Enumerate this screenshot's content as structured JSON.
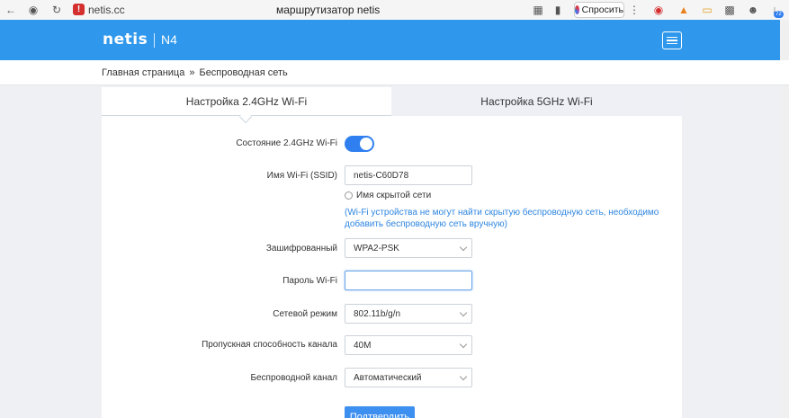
{
  "browser": {
    "url": "netis.cc",
    "page_title": "маршрутизатор netis",
    "ask_label": "Спросить",
    "security_badge": "!",
    "counter_badge": "72"
  },
  "header": {
    "brand": "netis",
    "model": "N4"
  },
  "breadcrumb": {
    "home": "Главная страница",
    "separator": "»",
    "current": "Беспроводная сеть"
  },
  "tabs": [
    {
      "label": "Настройка 2.4GHz Wi-Fi",
      "active": true
    },
    {
      "label": "Настройка 5GHz Wi-Fi",
      "active": false
    }
  ],
  "form": {
    "state_label": "Состояние 2.4GHz Wi-Fi",
    "state_on": true,
    "ssid_label": "Имя Wi-Fi (SSID)",
    "ssid_value": "netis-C60D78",
    "hidden_label": "Имя скрытой сети",
    "hidden_hint": "(Wi-Fi устройства не могут найти скрытую беспроводную сеть, необходимо добавить беспроводную сеть вручную)",
    "encryption_label": "Зашифрованный",
    "encryption_value": "WPA2-PSK",
    "password_label": "Пароль Wi-Fi",
    "password_value": "",
    "mode_label": "Сетевой режим",
    "mode_value": "802.11b/g/n",
    "bandwidth_label": "Пропускная способность канала",
    "bandwidth_value": "40M",
    "channel_label": "Беспроводной канал",
    "channel_value": "Автоматический",
    "confirm_label": "Подтвердить"
  },
  "colors": {
    "header_bg": "#2f98ec",
    "accent": "#2f7ff0",
    "hint_text": "#2f86e0"
  }
}
